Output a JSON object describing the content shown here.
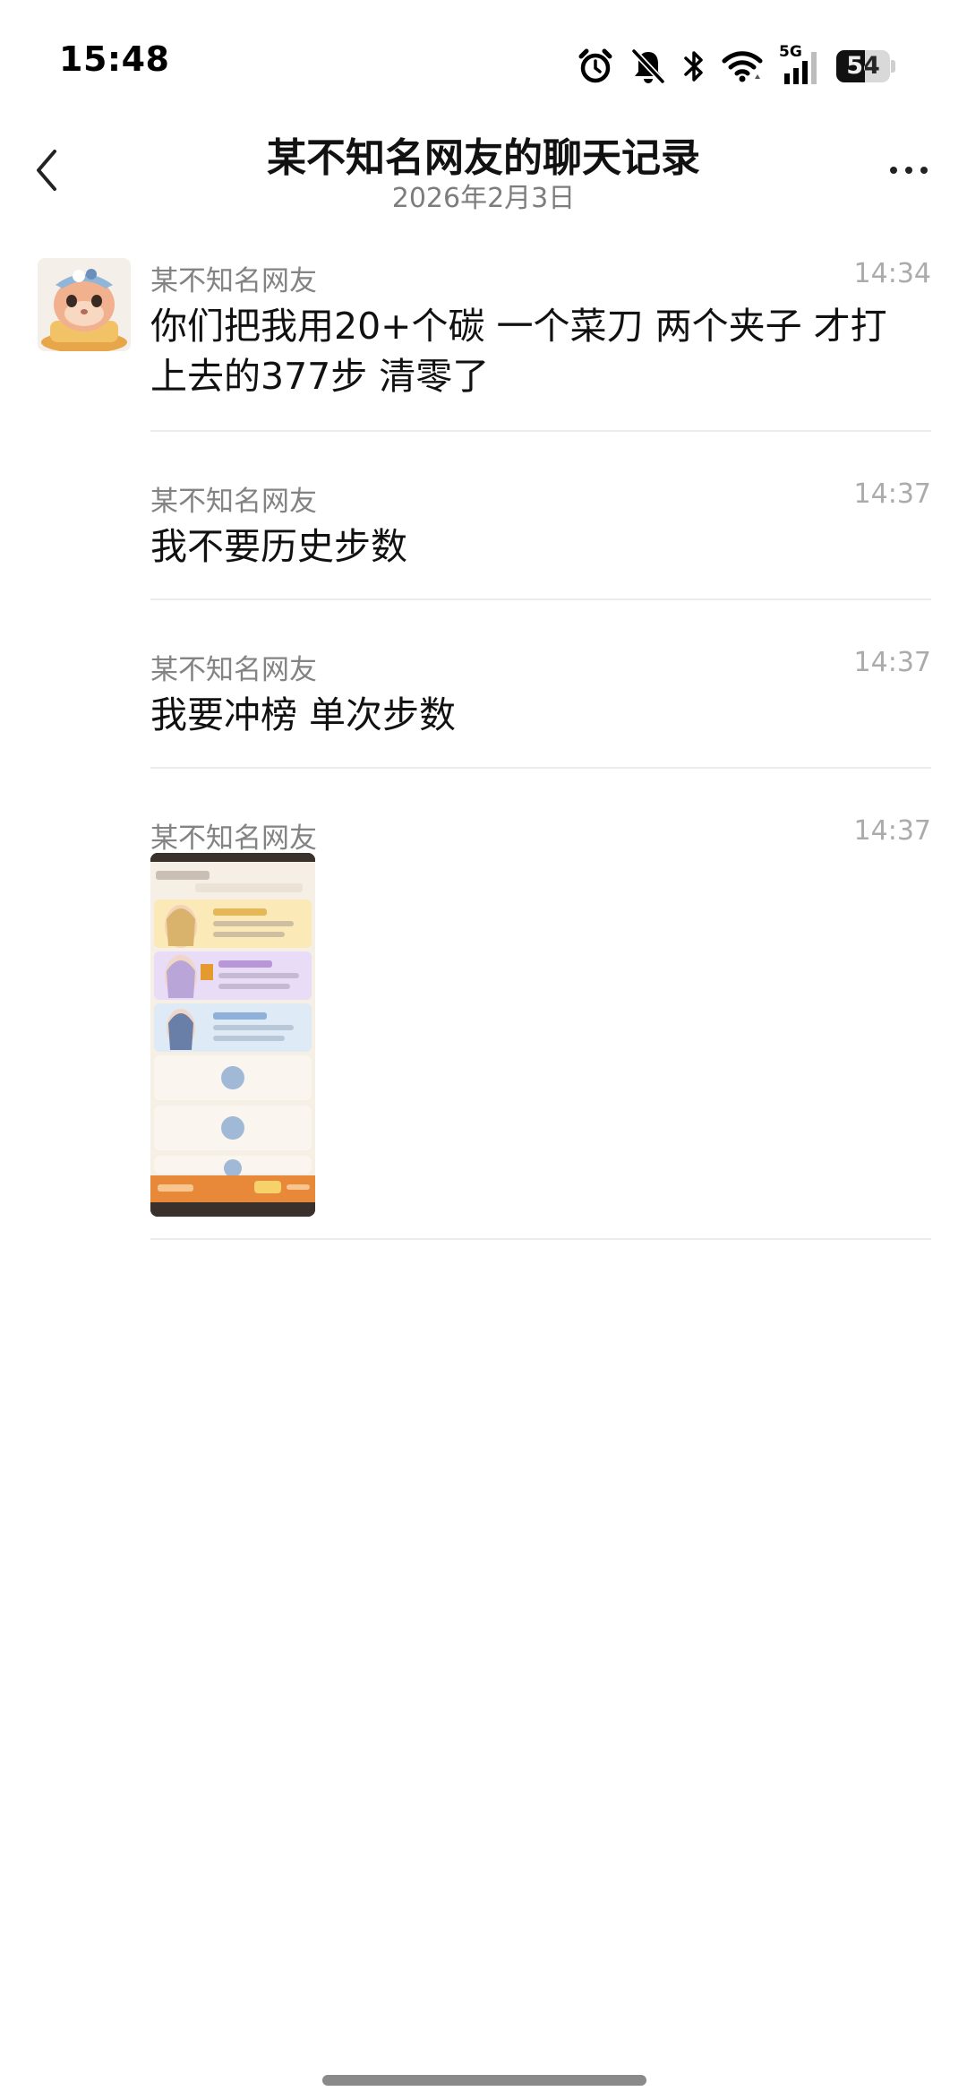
{
  "status_bar": {
    "time": "15:48",
    "network": "5G",
    "battery_level": "54",
    "battery_fraction": 0.54,
    "icons": [
      "alarm-icon",
      "mute-bell-icon",
      "bluetooth-icon",
      "wifi-icon",
      "cellular-5g-icon",
      "battery-icon"
    ]
  },
  "header": {
    "title": "某不知名网友的聊天记录",
    "subtitle": "2026年2月3日",
    "back_icon": "chevron-left-icon",
    "more_icon": "more-dots-icon"
  },
  "messages": [
    {
      "sender": "某不知名网友",
      "time": "14:34",
      "text_line1": "你们把我用20+个碳 一个菜刀 两个夹子 才打",
      "text_line2": "上去的377步 清零了"
    },
    {
      "sender": "某不知名网友",
      "time": "14:37",
      "text": "我不要历史步数"
    },
    {
      "sender": "某不知名网友",
      "time": "14:37",
      "text": "我要冲榜 单次步数"
    },
    {
      "sender": "某不知名网友",
      "time": "14:37",
      "image": "screenshot-thumbnail"
    }
  ],
  "colors": {
    "background": "#ffffff",
    "divider": "#ececec",
    "secondary_text": "#838383",
    "time_text": "#ababab"
  }
}
